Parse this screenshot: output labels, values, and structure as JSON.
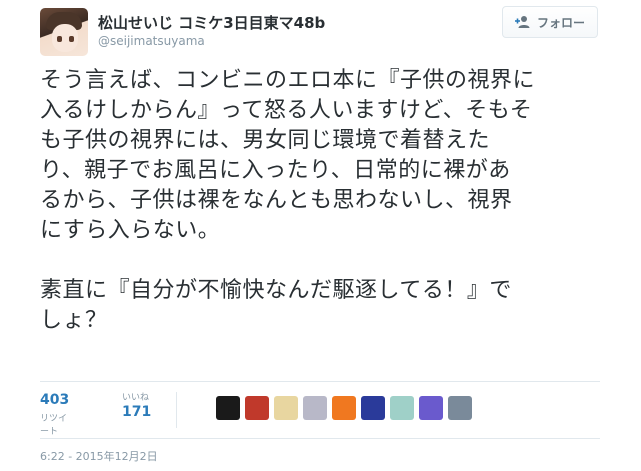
{
  "user": {
    "display_name": "松山せいじ コミケ3日目東マ48b",
    "screen_name": "@seijimatsuyama"
  },
  "follow_button": {
    "label": "フォロー",
    "icon": "follow-user-plus-icon"
  },
  "tweet": {
    "text": "そう言えば、コンビニのエロ本に『子供の視界に\n入るけしからん』って怒る人いますけど、そもそ\nも子供の視界には、男女同じ環境で着替えた\nり、親子でお風呂に入ったり、日常的に裸があ\nるから、子供は裸をなんとも思わないし、視界\nにすら入らない。\n\n素直に『自分が不愉快なんだ駆逐してる！』で\nしょ？"
  },
  "stats": {
    "retweets": {
      "value": "403",
      "label": "リツイート"
    },
    "favorites": {
      "value": "171",
      "label": "いいね"
    }
  },
  "favoriters": [
    {
      "name": "favoriter-avatar-1",
      "color": "#1a1a1a"
    },
    {
      "name": "favoriter-avatar-2",
      "color": "#c0392b"
    },
    {
      "name": "favoriter-avatar-3",
      "color": "#e8d6a0"
    },
    {
      "name": "favoriter-avatar-4",
      "color": "#b8b8c8"
    },
    {
      "name": "favoriter-avatar-5",
      "color": "#f07820"
    },
    {
      "name": "favoriter-avatar-6",
      "color": "#2a3a9a"
    },
    {
      "name": "favoriter-avatar-7",
      "color": "#9fd0c8"
    },
    {
      "name": "favoriter-avatar-8",
      "color": "#6a5acd"
    },
    {
      "name": "favoriter-avatar-9",
      "color": "#7a8a9a"
    }
  ],
  "timestamp": "6:22 - 2015年12月2日",
  "colors": {
    "link_blue": "#2b7bb9",
    "muted": "#8899a6",
    "text": "#292f33",
    "border": "#e1e8ed"
  }
}
